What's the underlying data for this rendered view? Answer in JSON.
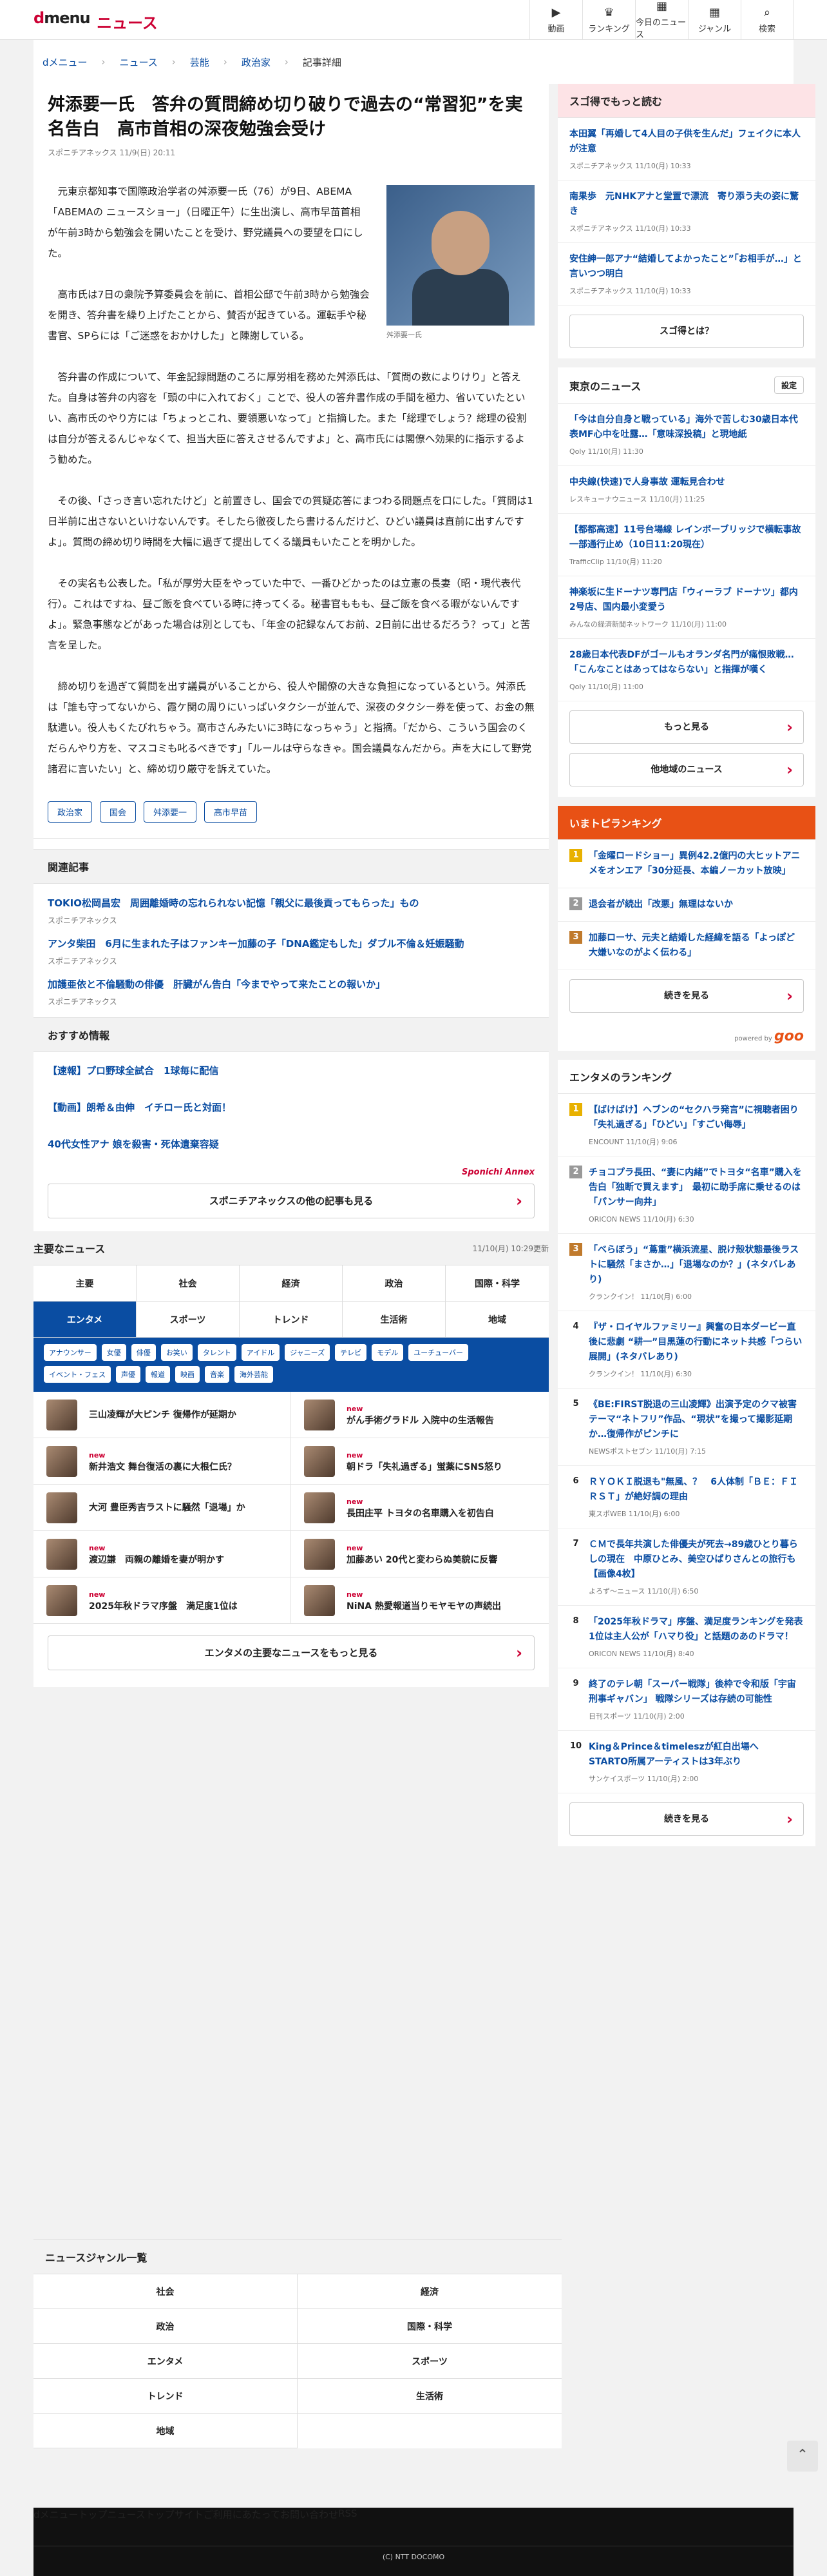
{
  "header": {
    "logo": "dmenu",
    "site": "ニュース",
    "nav": [
      {
        "label": "動画",
        "icon": "▶"
      },
      {
        "label": "ランキング",
        "icon": "♛"
      },
      {
        "label": "今日のニュース",
        "icon": "▦"
      },
      {
        "label": "ジャンル",
        "icon": "▦"
      },
      {
        "label": "検索",
        "icon": "⌕"
      }
    ]
  },
  "breadcrumb": [
    "dメニュー",
    "ニュース",
    "芸能",
    "政治家",
    "記事詳細"
  ],
  "article": {
    "title": "舛添要一氏　答弁の質問締め切り破りで過去の“常習犯”を実名告白　高市首相の深夜勉強会受け",
    "byline": "スポニチアネックス 11/9(日) 20:11",
    "photo_caption": "舛添要一氏",
    "paragraphs": [
      "元東京都知事で国際政治学者の舛添要一氏（76）が9日、ABEMA「ABEMAの ニュースショー」（日曜正午）に生出演し、高市早苗首相が午前3時から勉強会を開いたことを受け、野党議員への要望を口にした。",
      "高市氏は7日の衆院予算委員会を前に、首相公邸で午前3時から勉強会を開き、答弁書を繰り上げたことから、賛否が起きている。運転手や秘書官、SPらには「ご迷惑をおかけした」と陳謝している。",
      "答弁書の作成について、年金記録問題のころに厚労相を務めた舛添氏は、「質問の数によりけり」と答えた。自身は答弁の内容を「頭の中に入れておく」ことで、役人の答弁書作成の手間を極力、省いていたといい、高市氏のやり方には「ちょっとこれ、要領悪いなって」と指摘した。また「総理でしょう？総理の役割は自分が答えるんじゃなくて、担当大臣に答えさせるんですよ」と、高市氏には閣僚へ効果的に指示するよう勧めた。",
      "その後、「さっき言い忘れたけど」と前置きし、国会での質疑応答にまつわる問題点を口にした。「質問は1日半前に出さないといけないんです。そしたら徹夜したら書けるんだけど、ひどい議員は直前に出すんですよ」。質問の締め切り時間を大幅に過ぎて提出してくる議員もいたことを明かした。",
      "その実名も公表した。「私が厚労大臣をやっていた中で、一番ひどかったのは立憲の長妻（昭・現代表代行）。これはですね、昼ご飯を食べている時に持ってくる。秘書官ももも、昼ご飯を食べる暇がないんですよ」。緊急事態などがあった場合は別としても、「年金の記録なんてお前、2日前に出せるだろう？って」と苦言を呈した。",
      "締め切りを過ぎて質問を出す議員がいることから、役人や閣僚の大きな負担になっているという。舛添氏は「誰も守ってないから、霞ケ関の周りにいっぱいタクシーが並んで、深夜のタクシー券を使って、お金の無駄遣い。役人もくたびれちゃう。高市さんみたいに3時になっちゃう」と指摘。「だから、こういう国会のくだらんやり方を、マスコミも叱るべきです」「ルールは守らなきゃ。国会議員なんだから。声を大にして野党諸君に言いたい」と、締め切り厳守を訴えていた。"
    ],
    "tags": [
      "政治家",
      "国会",
      "舛添要一",
      "高市早苗"
    ]
  },
  "related": {
    "heading": "関連記事",
    "items": [
      {
        "title": "TOKIO松岡昌宏　周囲離婚時の忘れられない記憶「親父に最後貢ってもらった」もの",
        "source": "スポニチアネックス"
      },
      {
        "title": "アンタ柴田　6月に生まれた子はファンキー加藤の子「DNA鑑定もした」ダブル不倫＆妊娠騒動",
        "source": "スポニチアネックス"
      },
      {
        "title": "加護亜依と不倫騒動の俳優　肝臓がん告白「今までやって来たことの報いか」",
        "source": "スポニチアネックス"
      }
    ]
  },
  "recommend": {
    "heading": "おすすめ情報",
    "items": [
      "【速報】プロ野球全試合　1球毎に配信",
      "【動画】朗希＆由伸　イチロー氏と対面！",
      "40代女性アナ 娘を殺害・死体遺棄容疑"
    ],
    "annex_label": "Sponichi Annex",
    "more": "スポニチアネックスの他の記事も見る"
  },
  "major": {
    "heading": "主要なニュース",
    "updated": "11/10(月) 10:29更新",
    "tabs": [
      "主要",
      "社会",
      "経済",
      "政治",
      "国際・科学",
      "エンタメ",
      "スポーツ",
      "トレンド",
      "生活術",
      "地域"
    ],
    "subtags": [
      "アナウンサー",
      "女優",
      "俳優",
      "お笑い",
      "タレント",
      "アイドル",
      "ジャニーズ",
      "テレビ",
      "モデル",
      "ユーチューバー",
      "イベント・フェス",
      "声優",
      "報道",
      "映画",
      "音楽",
      "海外芸能"
    ],
    "items": [
      {
        "new": "",
        "title": "三山凌輝が大ピンチ 復帰作が延期か"
      },
      {
        "new": "new",
        "title": "がん手術グラドル 入院中の生活報告"
      },
      {
        "new": "new",
        "title": "新井浩文 舞台復活の裏に大根仁氏？"
      },
      {
        "new": "new",
        "title": "朝ドラ「失礼過ぎる」蛍薬にSNS怒り"
      },
      {
        "new": "",
        "title": "大河 豊臣秀吉ラストに騒然「退場」か"
      },
      {
        "new": "new",
        "title": "長田庄平 トヨタの名車購入を初告白"
      },
      {
        "new": "new",
        "title": "渡辺謙　両親の離婚を妻が明かす"
      },
      {
        "new": "new",
        "title": "加藤あい 20代と変わらぬ美貌に反響"
      },
      {
        "new": "new",
        "title": "2025年秋ドラマ序盤　満足度1位は"
      },
      {
        "new": "new",
        "title": "NiNA 熱愛報道当りモヤモヤの声続出"
      }
    ],
    "more": "エンタメの主要なニュースをもっと見る"
  },
  "sugoi": {
    "heading": "スゴ得でもっと読む",
    "items": [
      {
        "title": "本田翼「再婚して4人目の子供を生んだ」フェイクに本人が注意",
        "source": "スポニチアネックス 11/10(月) 10:33"
      },
      {
        "title": "南果歩　元NHKアナと堂置で漂流　寄り添う夫の姿に驚き",
        "source": "スポニチアネックス 11/10(月) 10:33"
      },
      {
        "title": "安住紳一郎アナ“結婚してよかったこと”「お相手が…」と言いつつ明白",
        "source": "スポニチアネックス 11/10(月) 10:33"
      }
    ],
    "btn": "スゴ得とは？"
  },
  "tokyo": {
    "heading": "東京のニュース",
    "setting": "設定",
    "items": [
      {
        "title": "「今は自分自身と戦っている」海外で苦しむ30歳日本代表MF心中を吐露…「意味深投稿」と現地紙",
        "source": "Qoly 11/10(月) 11:30"
      },
      {
        "title": "中央線(快速)で人身事故 運転見合わせ",
        "source": "レスキューナウニュース 11/10(月) 11:25"
      },
      {
        "title": "【都都高速】11号台場線 レインボーブリッジで横転事故 一部通行止め（10日11:20現在）",
        "source": "TrafficClip 11/10(月) 11:20"
      },
      {
        "title": "神楽坂に生ドーナツ専門店「ウィーラブ ドーナツ」都内2号店、国内最小変愛う",
        "source": "みんなの経済新聞ネットワーク 11/10(月) 11:00"
      },
      {
        "title": "28歳日本代表DFがゴールもオランダ名門が痛恨敗戦…「こんなことはあってはならない」と指揮が嘆く",
        "source": "Qoly 11/10(月) 11:00"
      }
    ],
    "more": "もっと見る",
    "region": "他地域のニュース"
  },
  "ima": {
    "heading": "いまトピランキング",
    "items": [
      {
        "title": "「金曜ロードショー」異例42.2億円の大ヒットアニメをオンエア「30分延長、本編ノーカット放映」"
      },
      {
        "title": "退会者が続出「改悪」無理はないか"
      },
      {
        "title": "加藤ローサ、元夫と結婚した経緯を語る「よっぽど大嫌いなのがよく伝わる」"
      }
    ],
    "btn": "続きを見る",
    "powered": "powered by",
    "goo": "goo"
  },
  "ent_rank": {
    "heading": "エンタメのランキング",
    "items": [
      {
        "title": "【ばけばけ】ヘブンの“セクハラ発言”に視聴者困り「失礼過ぎる」「ひどい」「すごい侮辱」",
        "source": "ENCOUNT 11/10(月) 9:06"
      },
      {
        "title": "チョコプラ長田、“妻に内緒”でトヨタ“名車”購入を告白「独断で買えます」　最初に助手席に乗せるのは「パンサー向井」",
        "source": "ORICON NEWS 11/10(月) 6:30"
      },
      {
        "title": "「べらぼう」“蔦重”横浜流星、脱け殻状態最後ラストに騒然「まさか…」「退場なのか？」(ネタバレあり)",
        "source": "クランクイン！ 11/10(月) 6:00"
      },
      {
        "title": "『ザ・ロイヤルファミリー』興奮の日本ダービー直後に悲劇 “耕一”目黒蓮の行動にネット共感「つらい展開」(ネタバレあり)",
        "source": "クランクイン！ 11/10(月) 6:30"
      },
      {
        "title": "《BE:FIRST脱退の三山凌輝》出演予定のクマ被害テーマ“ネトフリ”作品、“現状”を撮って撮影延期か…復帰作がピンチに",
        "source": "NEWSポストセブン 11/10(月) 7:15"
      },
      {
        "title": "ＲＹＯＫＩ脱退も\"無風、？　6人体制「ＢＥ：ＦＩＲＳＴ」が絶好調の理由",
        "source": "東スポWEB 11/10(月) 6:00"
      },
      {
        "title": "ＣＭで長年共演した俳優夫が死去→89歳ひとり暮らしの現在　中原ひとみ、美空ひばりさんとの旅行も【画像4枚】",
        "source": "よろず～ニュース 11/10(月) 6:50"
      },
      {
        "title": "「2025年秋ドラマ」序盤、満足度ランキングを発表　1位は主人公が「ハマり役」と話題のあのドラマ！",
        "source": "ORICON NEWS 11/10(月) 8:40"
      },
      {
        "title": "終了のテレ朝「スーパー戦隊」後枠で令和版「宇宙刑事ギャバン」 戦隊シリーズは存続の可能性",
        "source": "日刊スポーツ 11/10(月) 2:00"
      },
      {
        "title": "King＆Prince＆timeleszが紅白出場へ　STARTO所属アーティストは3年ぶり",
        "source": "サンケイスポーツ 11/10(月) 2:00"
      }
    ],
    "btn": "続きを見る"
  },
  "genre": {
    "heading": "ニュースジャンル一覧",
    "items": [
      "社会",
      "経済",
      "政治",
      "国際・科学",
      "エンタメ",
      "スポーツ",
      "トレンド",
      "生活術",
      "地域"
    ]
  },
  "footer": {
    "nav": [
      "dメニュートップ",
      "ニューストップ",
      "サイトご利用にあたって",
      "お問い合わせ",
      "RSS"
    ],
    "copy": "(C) NTT DOCOMO"
  }
}
